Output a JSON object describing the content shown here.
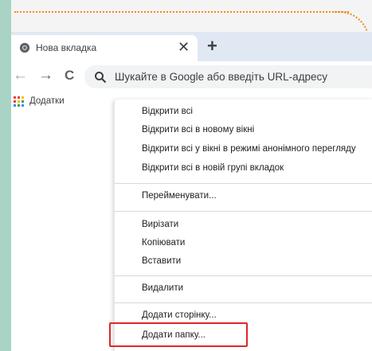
{
  "tab": {
    "title": "Нова вкладка",
    "close_glyph": "✕",
    "new_tab_glyph": "+"
  },
  "nav": {
    "back_glyph": "←",
    "forward_glyph": "→",
    "reload_glyph": "C"
  },
  "omnibox": {
    "placeholder": "Шукайте в Google або введіть URL-адресу"
  },
  "bookmarks_bar": {
    "apps_label": "Додатки"
  },
  "context_menu": {
    "open_all": "Відкрити всі",
    "open_all_new_window": "Відкрити всі в новому вікні",
    "open_all_incognito": "Відкрити всі у вікні в режимі анонімного перегляду",
    "open_all_new_tab_group": "Відкрити всі в новій групі вкладок",
    "rename": "Перейменувати...",
    "cut": "Вирізати",
    "copy": "Копіювати",
    "paste": "Вставити",
    "delete": "Видалити",
    "add_page": "Додати сторінку...",
    "add_folder": "Додати папку..."
  },
  "colors": {
    "highlight": "#e0262a",
    "decorative_dots": "#f08a1c",
    "side_strip": "#a9d3c4",
    "tabbar": "#dfe8f3"
  }
}
